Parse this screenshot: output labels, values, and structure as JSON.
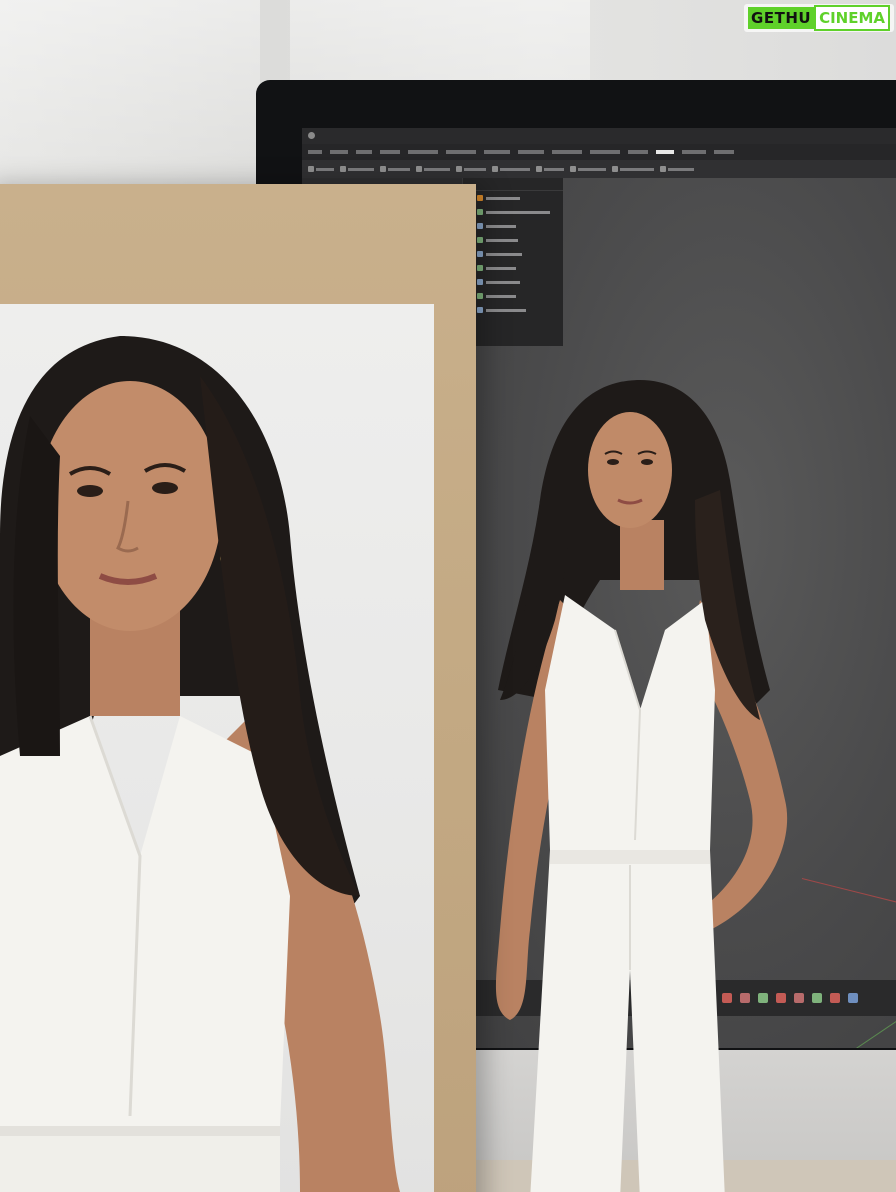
{
  "watermark": {
    "brand_left": "GETHU",
    "brand_right": "CINEMA",
    "accent_color": "#5fd12a"
  },
  "monitor_app": {
    "menu_active_index": 11,
    "icons": [
      "window-icon",
      "tool-icon",
      "timeline-key-icon"
    ],
    "timeline_key_colors": [
      "#c45b55",
      "#b86b6b",
      "#7fb37c",
      "#c45b55",
      "#b86b6b",
      "#7fb37c",
      "#c45b55",
      "#6f8fbf"
    ],
    "outliner_icon_colors": [
      "#d98a2b",
      "#7fb37c",
      "#8aa6c9",
      "#7fb37c",
      "#8aa6c9",
      "#7fb37c",
      "#8aa6c9",
      "#7fb37c",
      "#8aa6c9",
      "#7fb37c"
    ]
  },
  "scene": {
    "subjects": [
      "framed-portrait-print",
      "woman-on-monitor-viewport"
    ],
    "colors": {
      "board": "#c3a983",
      "print_bg": "#ebebea",
      "viewport_bg": "#4a4a4b",
      "outfit": "#f4f3ef",
      "hair": "#1e1a18",
      "skin": "#b98262"
    }
  }
}
